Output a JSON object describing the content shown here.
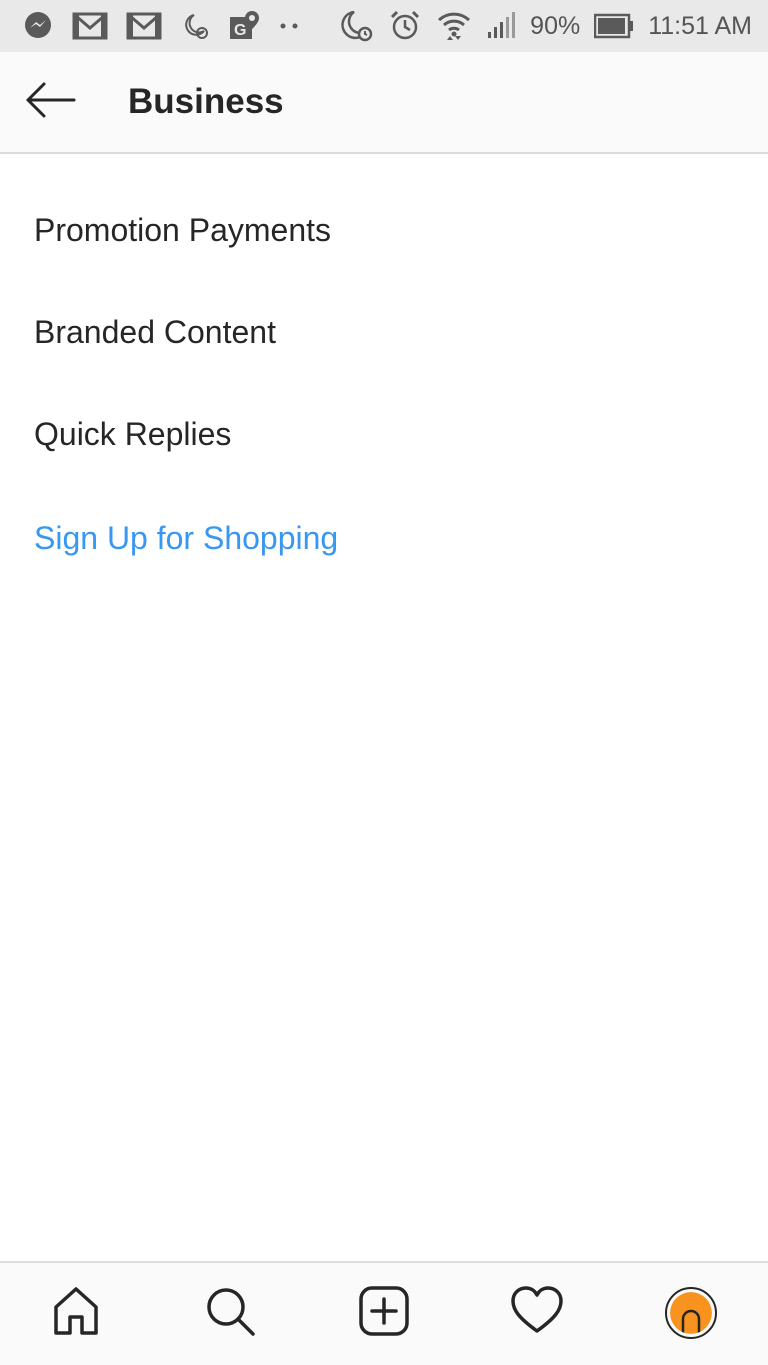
{
  "status_bar": {
    "battery": "90%",
    "time": "11:51 AM",
    "icons": [
      "messenger-icon",
      "gmail-icon",
      "gmail-icon",
      "do-not-disturb-icon",
      "maps-icon",
      "more-dots-icon",
      "moon-alarm-icon",
      "alarm-icon",
      "wifi-icon",
      "signal-icon",
      "battery-icon"
    ]
  },
  "header": {
    "title": "Business",
    "back_icon": "back-arrow-icon"
  },
  "menu": {
    "items": [
      {
        "label": "Promotion Payments"
      },
      {
        "label": "Branded Content"
      },
      {
        "label": "Quick Replies"
      },
      {
        "label": "Sign Up for Shopping"
      }
    ],
    "link_color": "#3897f0"
  },
  "bottom_nav": {
    "items": [
      "home-icon",
      "search-icon",
      "new-post-icon",
      "activity-heart-icon",
      "profile-avatar"
    ],
    "avatar_color": "#f7931e"
  }
}
